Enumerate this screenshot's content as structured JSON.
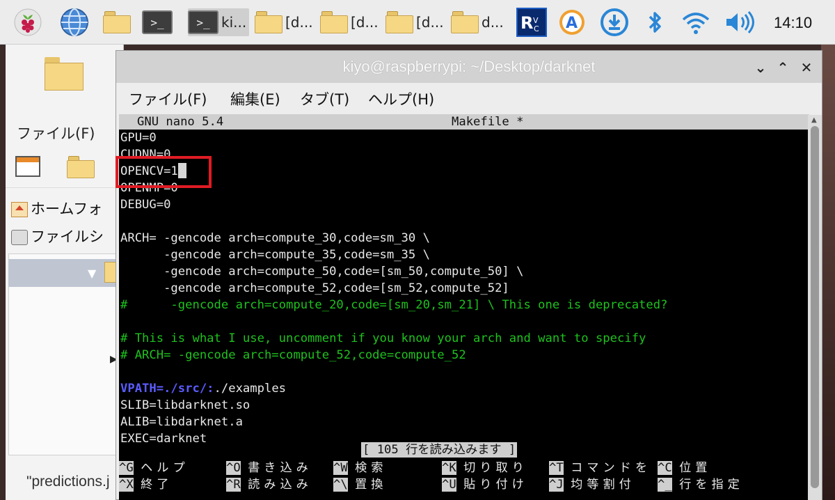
{
  "taskbar": {
    "items": [
      {
        "icon": "raspberry-icon",
        "label": ""
      },
      {
        "icon": "globe-icon",
        "label": ""
      },
      {
        "icon": "folder-icon",
        "label": ""
      },
      {
        "icon": "terminal-icon",
        "label": ""
      },
      {
        "icon": "terminal-icon",
        "label": "ki..."
      },
      {
        "icon": "folder-icon",
        "label": "[d..."
      },
      {
        "icon": "folder-icon",
        "label": "[d..."
      },
      {
        "icon": "folder-icon",
        "label": "[d..."
      },
      {
        "icon": "folder-icon",
        "label": "d..."
      }
    ],
    "tray": [
      "vnc-icon",
      "assistant-icon",
      "download-icon",
      "bluetooth-icon",
      "wifi-icon",
      "volume-icon"
    ],
    "clock": "14:10"
  },
  "file_manager": {
    "menu": "ファイル(F)",
    "places": [
      "ホームフォ",
      "ファイルシ"
    ],
    "status": "\"predictions.j"
  },
  "terminal": {
    "title": "kiyo@raspberrypi: ~/Desktop/darknet",
    "menu": [
      "ファイル(F)",
      "編集(E)",
      "タブ(T)",
      "ヘルプ(H)"
    ],
    "buttons": [
      "⌄",
      "⌃",
      "✕"
    ]
  },
  "nano": {
    "version": "GNU nano 5.4",
    "filename": "Makefile *",
    "status_message": "[ 105 行を読み込みます ]",
    "lines": [
      "GPU=0",
      "CUDNN=0",
      "OPENCV=1",
      "OPENMP=0",
      "DEBUG=0",
      "",
      "ARCH= -gencode arch=compute_30,code=sm_30 \\",
      "      -gencode arch=compute_35,code=sm_35 \\",
      "      -gencode arch=compute_50,code=[sm_50,compute_50] \\",
      "      -gencode arch=compute_52,code=[sm_52,compute_52]",
      "#      -gencode arch=compute_20,code=[sm_20,sm_21] \\ This one is deprecated?",
      "",
      "# This is what I use, uncomment if you know your arch and want to specify",
      "# ARCH= -gencode arch=compute_52,code=compute_52",
      "",
      "VPATH=./src/:",
      "./examples",
      "SLIB=libdarknet.so",
      "ALIB=libdarknet.a",
      "EXEC=darknet"
    ],
    "shortcuts_row1": [
      {
        "key": "^G",
        "label": "ヘルプ"
      },
      {
        "key": "^O",
        "label": "書き込み"
      },
      {
        "key": "^W",
        "label": "検索"
      },
      {
        "key": "^K",
        "label": "切り取り"
      },
      {
        "key": "^T",
        "label": "コマンドを"
      },
      {
        "key": "^C",
        "label": "位置"
      }
    ],
    "shortcuts_row2": [
      {
        "key": "^X",
        "label": "終了"
      },
      {
        "key": "^R",
        "label": "読み込み"
      },
      {
        "key": "^\\",
        "label": "置換"
      },
      {
        "key": "^U",
        "label": "貼り付け"
      },
      {
        "key": "^J",
        "label": "均等割付"
      },
      {
        "key": "^_",
        "label": "行を指定"
      }
    ]
  },
  "colors": {
    "highlight_box": "#e01b24",
    "comment": "#1ec21e",
    "vpath": "#5b5bff"
  }
}
